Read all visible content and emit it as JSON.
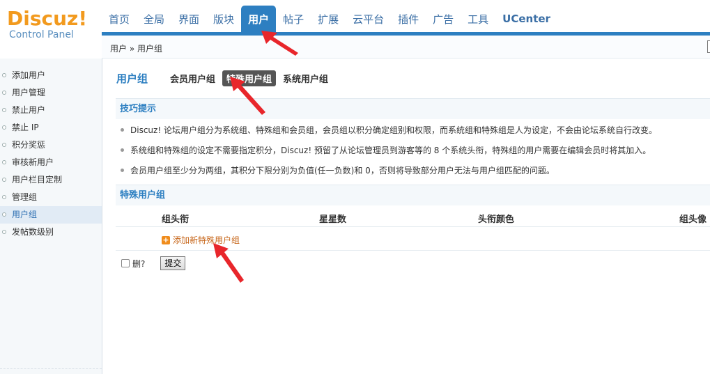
{
  "logo": {
    "brand": "Discuz!",
    "subtitle": "Control Panel"
  },
  "nav": {
    "items": [
      {
        "label": "首页",
        "active": false
      },
      {
        "label": "全局",
        "active": false
      },
      {
        "label": "界面",
        "active": false
      },
      {
        "label": "版块",
        "active": false
      },
      {
        "label": "用户",
        "active": true
      },
      {
        "label": "帖子",
        "active": false
      },
      {
        "label": "扩展",
        "active": false
      },
      {
        "label": "云平台",
        "active": false
      },
      {
        "label": "插件",
        "active": false
      },
      {
        "label": "广告",
        "active": false
      },
      {
        "label": "工具",
        "active": false
      },
      {
        "label": "UCenter",
        "active": false
      }
    ]
  },
  "breadcrumb": "用户 » 用户组",
  "sidebar": {
    "items": [
      {
        "label": "添加用户"
      },
      {
        "label": "用户管理"
      },
      {
        "label": "禁止用户"
      },
      {
        "label": "禁止 IP"
      },
      {
        "label": "积分奖惩"
      },
      {
        "label": "审核新用户"
      },
      {
        "label": "用户栏目定制"
      },
      {
        "label": "管理组"
      },
      {
        "label": "用户组"
      },
      {
        "label": "发帖数级别"
      }
    ],
    "active_index": 8
  },
  "main": {
    "title": "用户组",
    "tabs": [
      {
        "label": "会员用户组"
      },
      {
        "label": "特殊用户组"
      },
      {
        "label": "系统用户组"
      }
    ],
    "tips_title": "技巧提示",
    "tips": [
      "Discuz! 论坛用户组分为系统组、特殊组和会员组，会员组以积分确定组别和权限，而系统组和特殊组是人为设定，不会由论坛系统自行改变。",
      "系统组和特殊组的设定不需要指定积分，Discuz! 预留了从论坛管理员到游客等的 8 个系统头衔，特殊组的用户需要在编辑会员时将其加入。",
      "会员用户组至少分为两组，其积分下限分别为负值(任一负数)和 0，否则将导致部分用户无法与用户组匹配的问题。"
    ],
    "special_title": "特殊用户组",
    "columns": [
      "组头衔",
      "星星数",
      "头衔颜色",
      "组头像"
    ],
    "add_label": "添加新特殊用户组",
    "delete_label": "删?",
    "submit_label": "提交"
  },
  "colors": {
    "accent": "#2d7fc1",
    "logo_orange": "#f29a1e",
    "arrow_red": "#e8262b"
  }
}
